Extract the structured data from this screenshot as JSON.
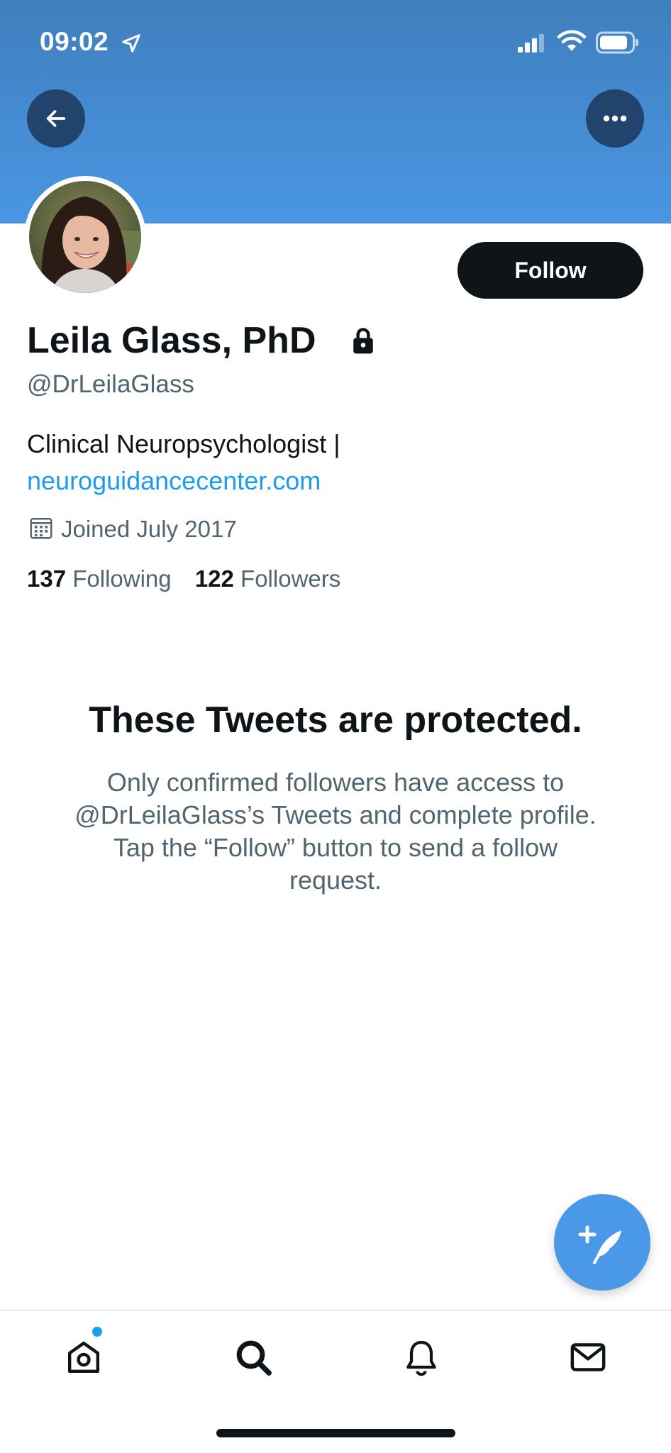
{
  "status_bar": {
    "time": "09:02",
    "location_icon": "location-arrow-icon",
    "signal_icon": "cellular-signal-icon",
    "wifi_icon": "wifi-icon",
    "battery_icon": "battery-icon"
  },
  "header": {
    "back_icon": "arrow-left-icon",
    "more_icon": "more-dots-icon",
    "banner_color": "#4a96e3"
  },
  "profile": {
    "display_name": "Leila Glass, PhD",
    "protected_icon": "lock-icon",
    "handle": "@DrLeilaGlass",
    "bio": "Clinical Neuropsychologist |",
    "website": "neuroguidancecenter.com",
    "joined_icon": "calendar-icon",
    "joined": "Joined July 2017",
    "following_count": "137",
    "following_label": "Following",
    "followers_count": "122",
    "followers_label": "Followers",
    "follow_button_label": "Follow"
  },
  "protected_notice": {
    "title": "These Tweets are protected.",
    "body": "Only confirmed followers have access to @DrLeilaGlass’s Tweets and complete profile. Tap the “Follow” button to send a follow request."
  },
  "compose": {
    "icon": "compose-feather-icon",
    "color": "#4a99e9"
  },
  "tab_bar": {
    "tabs": [
      {
        "name": "home",
        "icon": "home-icon",
        "has_badge": true
      },
      {
        "name": "search",
        "icon": "search-icon",
        "active": true
      },
      {
        "name": "notifications",
        "icon": "bell-icon"
      },
      {
        "name": "messages",
        "icon": "envelope-icon"
      }
    ],
    "badge_color": "#1d9bf0"
  }
}
